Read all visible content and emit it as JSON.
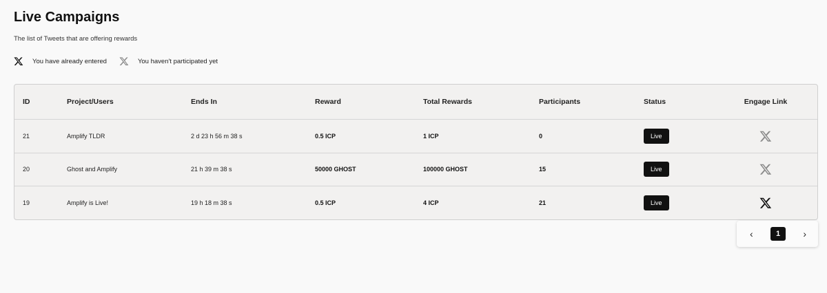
{
  "header": {
    "title": "Live Campaigns",
    "subtitle": "The list of Tweets that are offering rewards"
  },
  "legend": [
    {
      "icon": "x-logo-icon",
      "variant": "dark",
      "label": "You have already entered"
    },
    {
      "icon": "x-logo-icon",
      "variant": "grey",
      "label": "You haven't participated yet"
    }
  ],
  "table": {
    "columns": [
      "ID",
      "Project/Users",
      "Ends In",
      "Reward",
      "Total Rewards",
      "Participants",
      "Status",
      "Engage Link"
    ],
    "rows": [
      {
        "id": "21",
        "project": "Amplify TLDR",
        "ends_in": "2 d 23 h 56 m 38 s",
        "reward": "0.5 ICP",
        "total_rewards": "1 ICP",
        "participants": "0",
        "status": "Live",
        "engaged": false
      },
      {
        "id": "20",
        "project": "Ghost and Amplify",
        "ends_in": "21 h 39 m 38 s",
        "reward": "50000 GHOST",
        "total_rewards": "100000 GHOST",
        "participants": "15",
        "status": "Live",
        "engaged": false
      },
      {
        "id": "19",
        "project": "Amplify is Live!",
        "ends_in": "19 h 18 m 38 s",
        "reward": "0.5 ICP",
        "total_rewards": "4 ICP",
        "participants": "21",
        "status": "Live",
        "engaged": true
      }
    ]
  },
  "pagination": {
    "prev": "‹",
    "current": "1",
    "next": "›"
  },
  "colors": {
    "background": "#f9f9f9",
    "table_bg": "#f2f1f0",
    "badge_bg": "#111111",
    "icon_entered": "#111111",
    "icon_not_entered": "#8a8a8a"
  }
}
